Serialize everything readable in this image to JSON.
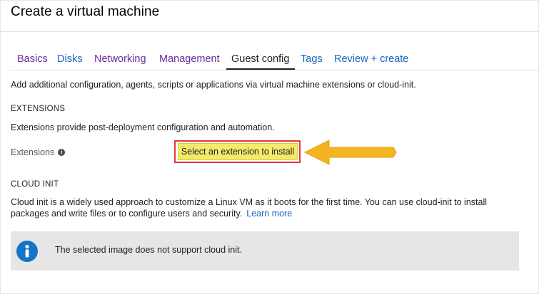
{
  "page": {
    "title": "Create a virtual machine"
  },
  "tabs": [
    {
      "label": "Basics",
      "state": "visited"
    },
    {
      "label": "Disks",
      "state": "link"
    },
    {
      "label": "Networking",
      "state": "visited"
    },
    {
      "label": "Management",
      "state": "visited"
    },
    {
      "label": "Guest config",
      "state": "active"
    },
    {
      "label": "Tags",
      "state": "link"
    },
    {
      "label": "Review + create",
      "state": "link"
    }
  ],
  "intro": "Add additional configuration, agents, scripts or applications via virtual machine extensions or cloud-init.",
  "extensions": {
    "heading": "EXTENSIONS",
    "description": "Extensions provide post-deployment configuration and automation.",
    "field_label": "Extensions",
    "info_icon": "info-circle-icon",
    "button_label": "Select an extension to install"
  },
  "cloud_init": {
    "heading": "CLOUD INIT",
    "description": "Cloud init is a widely used approach to customize a Linux VM as it boots for the first time. You can use cloud-init to install packages and write files or to configure users and security.",
    "learn_more": "Learn more",
    "banner_icon": "info-icon",
    "banner_text": "The selected image does not support cloud init."
  },
  "colors": {
    "visited_tab": "#6a2a9a",
    "link": "#1565c0",
    "highlight_button": "#f4ea6b",
    "highlight_outline": "#e53935",
    "arrow": "#f2b521",
    "banner_bg": "#e6e6e6",
    "info_blue": "#1573c8"
  }
}
